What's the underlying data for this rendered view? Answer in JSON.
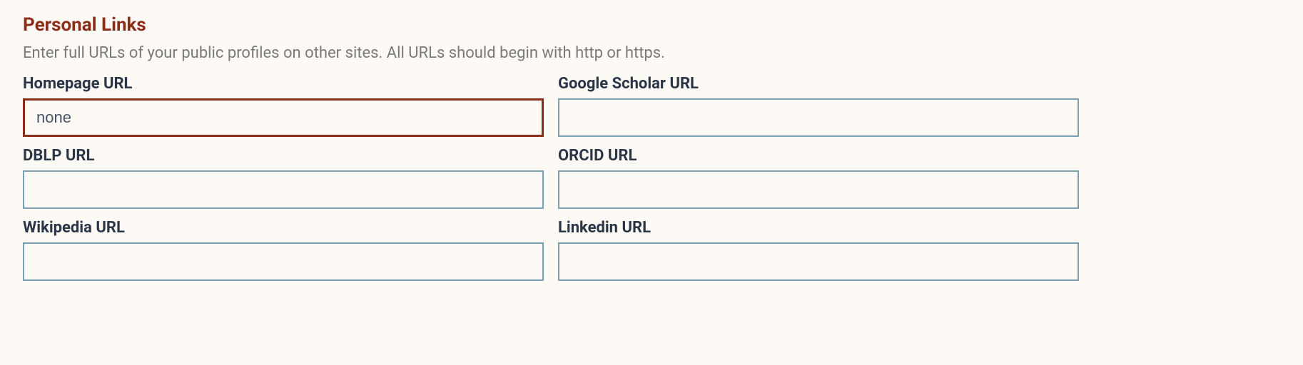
{
  "section": {
    "title": "Personal Links",
    "description": "Enter full URLs of your public profiles on other sites. All URLs should begin with http or https."
  },
  "fields": {
    "homepage": {
      "label": "Homepage URL",
      "value": "none"
    },
    "google_scholar": {
      "label": "Google Scholar URL",
      "value": ""
    },
    "dblp": {
      "label": "DBLP URL",
      "value": ""
    },
    "orcid": {
      "label": "ORCID URL",
      "value": ""
    },
    "wikipedia": {
      "label": "Wikipedia URL",
      "value": ""
    },
    "linkedin": {
      "label": "Linkedin URL",
      "value": ""
    }
  }
}
